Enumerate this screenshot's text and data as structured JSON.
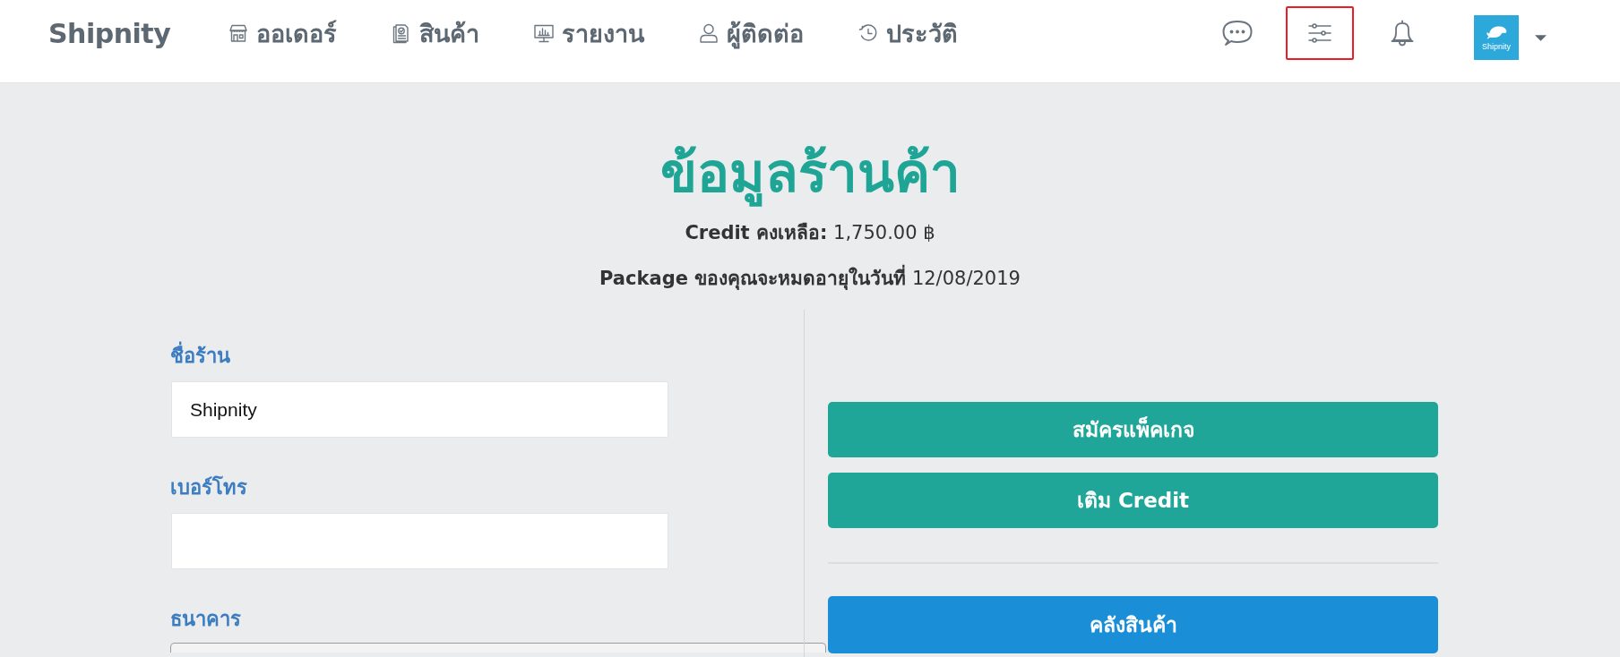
{
  "navbar": {
    "brand": "Shipnity",
    "items": [
      {
        "label": "ออเดอร์"
      },
      {
        "label": "สินค้า"
      },
      {
        "label": "รายงาน"
      },
      {
        "label": "ผู้ติดต่อ"
      },
      {
        "label": "ประวัติ"
      }
    ],
    "actions": [
      {
        "highlighted": false
      },
      {
        "highlighted": true
      },
      {
        "highlighted": false
      }
    ],
    "account": {
      "logo_text": "Shipnity"
    }
  },
  "header": {
    "title": "ข้อมูลร้านค้า",
    "credit": "**Credit คงเหลือ:** 1,750.00 ฿",
    "package": "**Package ของคุณจะหมดอายุในวันที่** 12/08/2019"
  },
  "form": {
    "fields": [
      {
        "kind": "input",
        "label": "ชื่อร้าน",
        "value": "Shipnity"
      },
      {
        "kind": "input",
        "label": "เบอร์โทร"
      },
      {
        "kind": "select",
        "label": "ธนาคาร"
      }
    ]
  },
  "button_groups": [
    {
      "buttons": [
        {
          "kind": "success",
          "label": "สมัครแพ็คเกจ"
        },
        {
          "kind": "success",
          "label": "เติม Credit"
        }
      ]
    },
    {
      "buttons": [
        {
          "kind": "primary",
          "label": "คลังสินค้า"
        }
      ]
    }
  ]
}
